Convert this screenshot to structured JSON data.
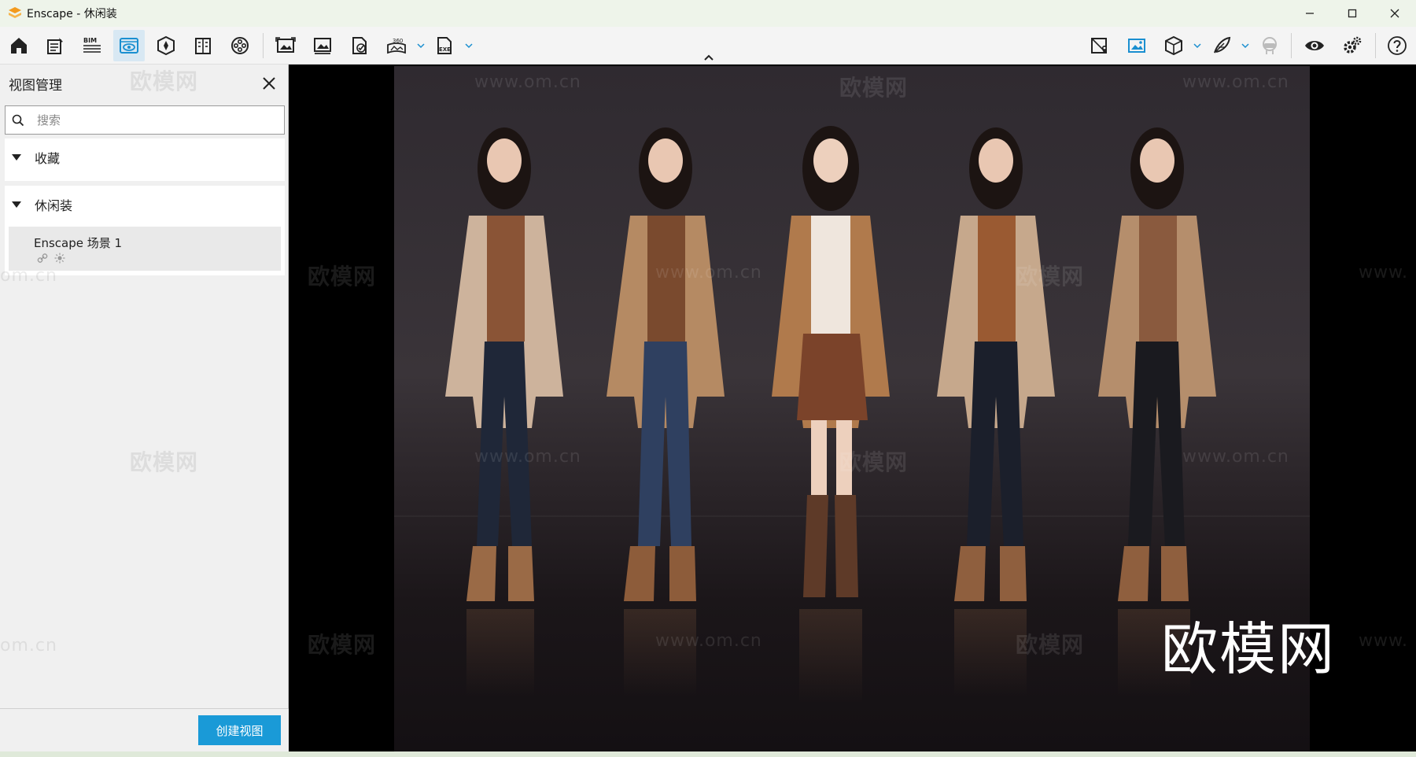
{
  "window": {
    "title": "Enscape - 休闲装",
    "controls": [
      "minimize-icon",
      "maximize-icon",
      "close-icon"
    ]
  },
  "toolbar": {
    "left_icons": [
      "home-icon",
      "notes-icon",
      "bim-icon",
      "view-management-icon",
      "asset-library-icon",
      "materials-icon",
      "video-editor-icon",
      "screenshot-icon",
      "batch-render-icon",
      "web-export-icon",
      "panorama-360-icon",
      "exe-export-icon"
    ],
    "bim_label": "BIM",
    "pano_label": "360",
    "exe_label": "EXE",
    "right_icons": [
      "map-pin-icon",
      "visual-settings-image-icon",
      "cube-icon",
      "feather-icon",
      "vr-headset-icon",
      "eye-icon",
      "settings-icon",
      "help-icon"
    ]
  },
  "panel": {
    "title": "视图管理",
    "search_placeholder": "搜索",
    "groups": [
      {
        "label": "收藏",
        "items": []
      },
      {
        "label": "休闲装",
        "items": [
          {
            "name": "Enscape 场景 1"
          }
        ]
      }
    ],
    "create_button": "创建视图"
  },
  "viewport": {
    "watermark_text": "欧模网",
    "watermark_url": "www.om.cn",
    "watermark_url_partial": "om.cn",
    "watermark_url_partial_right": "www.",
    "logo_text": "欧模网"
  },
  "colors": {
    "accent": "#1a9ad7",
    "titlebar": "#eef4ea",
    "panel": "#f0f0f0"
  }
}
